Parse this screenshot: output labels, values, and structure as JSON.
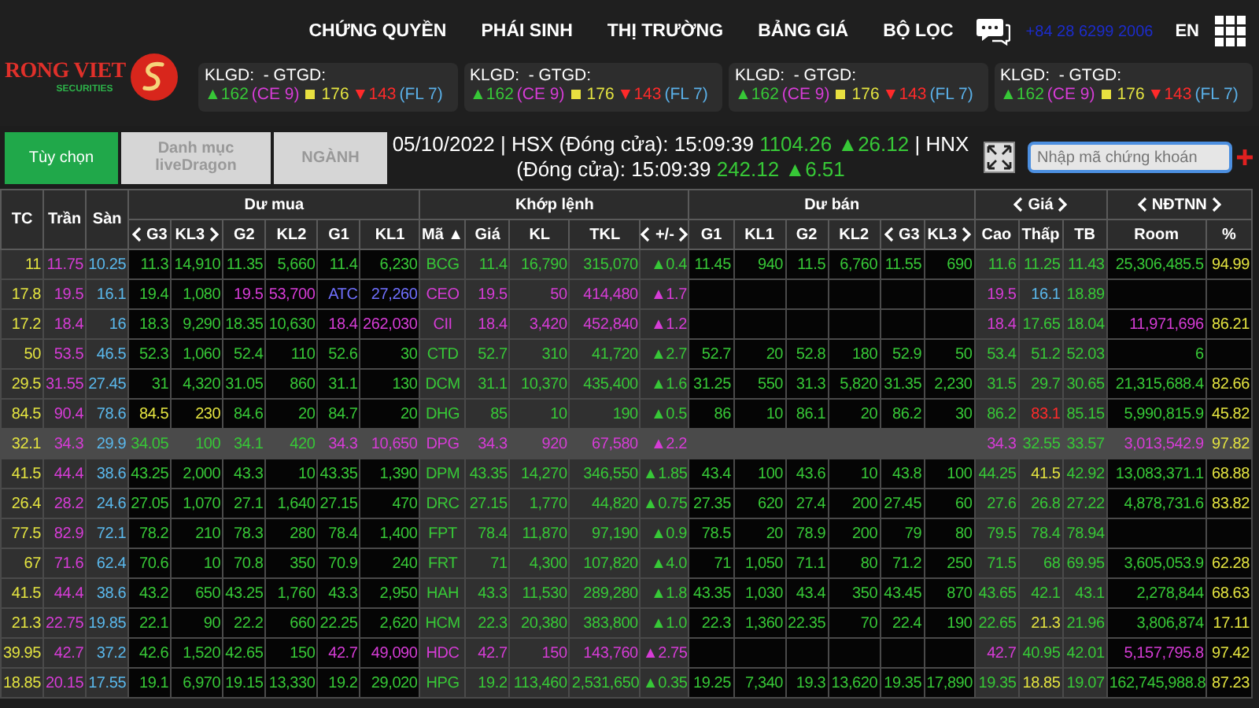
{
  "brand": {
    "name": "RONG VIET",
    "tagline": "SECURITIES"
  },
  "nav": {
    "items": [
      "CHỨNG QUYỀN",
      "PHÁI SINH",
      "THỊ TRƯỜNG",
      "BẢNG GIÁ",
      "BỘ LỌC"
    ],
    "hotline": "+84 28 6299 2006",
    "language": {
      "label": "EN",
      "selected": true
    }
  },
  "market_cards": [
    {
      "title": "KLGD:  - GTGD:",
      "up": "▲162",
      "ce": "(CE 9)",
      "ref": "176",
      "down": "▼143",
      "fl": "(FL 7)"
    },
    {
      "title": "KLGD:  - GTGD:",
      "up": "▲162",
      "ce": "(CE 9)",
      "ref": "176",
      "down": "▼143",
      "fl": "(FL 7)"
    },
    {
      "title": "KLGD:  - GTGD:",
      "up": "▲162",
      "ce": "(CE 9)",
      "ref": "176",
      "down": "▼143",
      "fl": "(FL 7)"
    },
    {
      "title": "KLGD:  - GTGD:",
      "up": "▲162",
      "ce": "(CE 9)",
      "ref": "176",
      "down": "▼143",
      "fl": "(FL 7)"
    }
  ],
  "toolbar_buttons": [
    {
      "label": "Tùy chọn",
      "selected": true
    },
    {
      "label": "Danh mục liveDragon",
      "selected": false
    },
    {
      "label": "NGÀNH",
      "selected": false
    }
  ],
  "ticker": [
    {
      "kind": "text",
      "text": "05/10/2022 | HSX (Đóng cửa): 15:09:39 "
    },
    {
      "kind": "up",
      "text": "1104.26 ▲26.12"
    },
    {
      "kind": "text",
      "text": " | HNX (Đóng cửa): 15:09:39 "
    },
    {
      "kind": "up",
      "text": "242.12 ▲6.51"
    }
  ],
  "search": {
    "placeholder": "Nhập mã chứng khoán"
  },
  "table": {
    "columns": [
      {
        "label": "TC"
      },
      {
        "label": "Trần"
      },
      {
        "label": "Sàn"
      },
      {
        "label": "Dư mua",
        "columns": [
          {
            "label": "G3",
            "prev": true
          },
          {
            "label": "KL3",
            "next": true
          },
          {
            "label": "G2"
          },
          {
            "label": "KL2"
          },
          {
            "label": "G1"
          },
          {
            "label": "KL1"
          }
        ]
      },
      {
        "label": "Khớp lệnh",
        "columns": [
          {
            "label": "Mã ▲"
          },
          {
            "label": "Giá"
          },
          {
            "label": "KL"
          },
          {
            "label": "TKL"
          },
          {
            "label": "+/-",
            "prev": true,
            "next": true
          }
        ]
      },
      {
        "label": "Dư bán",
        "columns": [
          {
            "label": "G1"
          },
          {
            "label": "KL1"
          },
          {
            "label": "G2"
          },
          {
            "label": "KL2"
          },
          {
            "label": "G3",
            "prev": true
          },
          {
            "label": "KL3",
            "next": true
          }
        ]
      },
      {
        "label": "Giá",
        "prev": true,
        "next": true,
        "columns": [
          {
            "label": "Cao"
          },
          {
            "label": "Thấp"
          },
          {
            "label": "TB"
          }
        ]
      },
      {
        "label": "NĐTNN",
        "prev": true,
        "next": true,
        "columns": [
          {
            "label": "Room"
          },
          {
            "label": "%"
          }
        ]
      }
    ],
    "rows": [
      {
        "ref": "11",
        "ceil": "11.75",
        "floor": "10.25",
        "buy": [
          "11.3",
          "14,910",
          "11.35",
          "5,660",
          "11.4",
          "6,230"
        ],
        "symbol": "BCG",
        "price": "11.4",
        "vol": "16,790",
        "total": "315,070",
        "change": "▲0.4",
        "sell": [
          "11.45",
          "940",
          "11.5",
          "6,760",
          "11.55",
          "690"
        ],
        "high": "11.6",
        "low": "11.25",
        "avg": "11.43",
        "room": "25,306,485.5",
        "pct": "94.99",
        "selected": false
      },
      {
        "ref": "17.8",
        "ceil": "19.5",
        "floor": "16.1",
        "buy": [
          "19.4",
          "1,080",
          "19.5",
          "53,700",
          "ATC",
          "27,260"
        ],
        "symbol": "CEO",
        "price": "19.5",
        "vol": "50",
        "total": "414,480",
        "change": "▲1.7",
        "high": "19.5",
        "low": "16.1",
        "avg": "18.89",
        "selected": false
      },
      {
        "ref": "17.2",
        "ceil": "18.4",
        "floor": "16",
        "buy": [
          "18.3",
          "9,290",
          "18.35",
          "10,630",
          "18.4",
          "262,030"
        ],
        "symbol": "CII",
        "price": "18.4",
        "vol": "3,420",
        "total": "452,840",
        "change": "▲1.2",
        "high": "18.4",
        "low": "17.65",
        "avg": "18.04",
        "room": "11,971,696",
        "pct": "86.21",
        "selected": false
      },
      {
        "ref": "50",
        "ceil": "53.5",
        "floor": "46.5",
        "buy": [
          "52.3",
          "1,060",
          "52.4",
          "110",
          "52.6",
          "30"
        ],
        "symbol": "CTD",
        "price": "52.7",
        "vol": "310",
        "total": "41,720",
        "change": "▲2.7",
        "sell": [
          "52.7",
          "20",
          "52.8",
          "180",
          "52.9",
          "50"
        ],
        "high": "53.4",
        "low": "51.2",
        "avg": "52.03",
        "room": "6",
        "selected": false
      },
      {
        "ref": "29.5",
        "ceil": "31.55",
        "floor": "27.45",
        "buy": [
          "31",
          "4,320",
          "31.05",
          "860",
          "31.1",
          "130"
        ],
        "symbol": "DCM",
        "price": "31.1",
        "vol": "10,370",
        "total": "435,400",
        "change": "▲1.6",
        "sell": [
          "31.25",
          "550",
          "31.3",
          "5,820",
          "31.35",
          "2,230"
        ],
        "high": "31.5",
        "low": "29.7",
        "avg": "30.65",
        "room": "21,315,688.4",
        "pct": "82.66",
        "selected": false
      },
      {
        "ref": "84.5",
        "ceil": "90.4",
        "floor": "78.6",
        "buy": [
          "84.5",
          "230",
          "84.6",
          "20",
          "84.7",
          "20"
        ],
        "symbol": "DHG",
        "price": "85",
        "vol": "10",
        "total": "190",
        "change": "▲0.5",
        "sell": [
          "86",
          "10",
          "86.1",
          "20",
          "86.2",
          "30"
        ],
        "high": "86.2",
        "low": "83.1",
        "avg": "85.15",
        "room": "5,990,815.9",
        "pct": "45.82",
        "selected": false
      },
      {
        "ref": "32.1",
        "ceil": "34.3",
        "floor": "29.9",
        "buy": [
          "34.05",
          "100",
          "34.1",
          "420",
          "34.3",
          "10,650"
        ],
        "symbol": "DPG",
        "price": "34.3",
        "vol": "920",
        "total": "67,580",
        "change": "▲2.2",
        "high": "34.3",
        "low": "32.55",
        "avg": "33.57",
        "room": "3,013,542.9",
        "pct": "97.82",
        "selected": true
      },
      {
        "ref": "41.5",
        "ceil": "44.4",
        "floor": "38.6",
        "buy": [
          "43.25",
          "2,000",
          "43.3",
          "10",
          "43.35",
          "1,390"
        ],
        "symbol": "DPM",
        "price": "43.35",
        "vol": "14,270",
        "total": "346,550",
        "change": "▲1.85",
        "sell": [
          "43.4",
          "100",
          "43.6",
          "10",
          "43.8",
          "100"
        ],
        "high": "44.25",
        "low": "41.5",
        "avg": "42.92",
        "room": "13,083,371.1",
        "pct": "68.88",
        "selected": false
      },
      {
        "ref": "26.4",
        "ceil": "28.2",
        "floor": "24.6",
        "buy": [
          "27.05",
          "1,070",
          "27.1",
          "1,640",
          "27.15",
          "470"
        ],
        "symbol": "DRC",
        "price": "27.15",
        "vol": "1,770",
        "total": "44,820",
        "change": "▲0.75",
        "sell": [
          "27.35",
          "620",
          "27.4",
          "200",
          "27.45",
          "60"
        ],
        "high": "27.6",
        "low": "26.8",
        "avg": "27.22",
        "room": "4,878,731.6",
        "pct": "83.82",
        "selected": false
      },
      {
        "ref": "77.5",
        "ceil": "82.9",
        "floor": "72.1",
        "buy": [
          "78.2",
          "210",
          "78.3",
          "280",
          "78.4",
          "1,400"
        ],
        "symbol": "FPT",
        "price": "78.4",
        "vol": "11,870",
        "total": "97,190",
        "change": "▲0.9",
        "sell": [
          "78.5",
          "20",
          "78.9",
          "200",
          "79",
          "80"
        ],
        "high": "79.5",
        "low": "78.4",
        "avg": "78.94",
        "selected": false
      },
      {
        "ref": "67",
        "ceil": "71.6",
        "floor": "62.4",
        "buy": [
          "70.6",
          "10",
          "70.8",
          "350",
          "70.9",
          "240"
        ],
        "symbol": "FRT",
        "price": "71",
        "vol": "4,300",
        "total": "107,820",
        "change": "▲4.0",
        "sell": [
          "71",
          "1,050",
          "71.1",
          "80",
          "71.2",
          "250"
        ],
        "high": "71.5",
        "low": "68",
        "avg": "69.95",
        "room": "3,605,053.9",
        "pct": "62.28",
        "selected": false
      },
      {
        "ref": "41.5",
        "ceil": "44.4",
        "floor": "38.6",
        "buy": [
          "43.2",
          "650",
          "43.25",
          "1,760",
          "43.3",
          "2,950"
        ],
        "symbol": "HAH",
        "price": "43.3",
        "vol": "11,530",
        "total": "289,280",
        "change": "▲1.8",
        "sell": [
          "43.35",
          "1,030",
          "43.4",
          "350",
          "43.45",
          "870"
        ],
        "high": "43.65",
        "low": "42.1",
        "avg": "43.1",
        "room": "2,278,844",
        "pct": "68.63",
        "selected": false
      },
      {
        "ref": "21.3",
        "ceil": "22.75",
        "floor": "19.85",
        "buy": [
          "22.1",
          "90",
          "22.2",
          "660",
          "22.25",
          "2,620"
        ],
        "symbol": "HCM",
        "price": "22.3",
        "vol": "20,380",
        "total": "383,800",
        "change": "▲1.0",
        "sell": [
          "22.3",
          "1,360",
          "22.35",
          "70",
          "22.4",
          "190"
        ],
        "high": "22.65",
        "low": "21.3",
        "avg": "21.96",
        "room": "3,806,874",
        "pct": "17.11",
        "selected": false
      },
      {
        "ref": "39.95",
        "ceil": "42.7",
        "floor": "37.2",
        "buy": [
          "42.6",
          "1,520",
          "42.65",
          "150",
          "42.7",
          "49,090"
        ],
        "symbol": "HDC",
        "price": "42.7",
        "vol": "150",
        "total": "143,760",
        "change": "▲2.75",
        "high": "42.7",
        "low": "40.95",
        "avg": "42.01",
        "room": "5,157,795.8",
        "pct": "97.42",
        "selected": false
      },
      {
        "ref": "18.85",
        "ceil": "20.15",
        "floor": "17.55",
        "buy": [
          "19.1",
          "6,970",
          "19.15",
          "13,330",
          "19.2",
          "29,020"
        ],
        "symbol": "HPG",
        "price": "19.2",
        "vol": "113,460",
        "total": "2,531,650",
        "change": "▲0.35",
        "sell": [
          "19.25",
          "7,340",
          "19.3",
          "13,620",
          "19.35",
          "17,890"
        ],
        "high": "19.35",
        "low": "18.85",
        "avg": "19.07",
        "room": "162,745,988.8",
        "pct": "87.23",
        "selected": false
      }
    ]
  }
}
